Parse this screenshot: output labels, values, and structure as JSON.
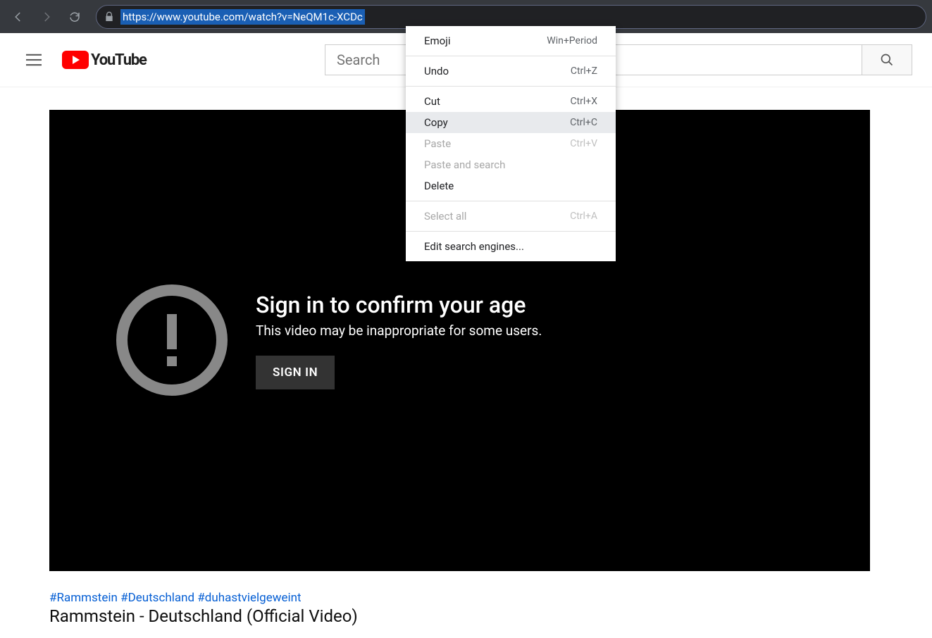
{
  "browser": {
    "url": "https://www.youtube.com/watch?v=NeQM1c-XCDc"
  },
  "context_menu": {
    "items": [
      {
        "label": "Emoji",
        "shortcut": "Win+Period",
        "state": "normal"
      },
      {
        "sep": true
      },
      {
        "label": "Undo",
        "shortcut": "Ctrl+Z",
        "state": "normal"
      },
      {
        "sep": true
      },
      {
        "label": "Cut",
        "shortcut": "Ctrl+X",
        "state": "normal"
      },
      {
        "label": "Copy",
        "shortcut": "Ctrl+C",
        "state": "hover"
      },
      {
        "label": "Paste",
        "shortcut": "Ctrl+V",
        "state": "disabled"
      },
      {
        "label": "Paste and search",
        "shortcut": "",
        "state": "disabled"
      },
      {
        "label": "Delete",
        "shortcut": "",
        "state": "normal"
      },
      {
        "sep": true
      },
      {
        "label": "Select all",
        "shortcut": "Ctrl+A",
        "state": "disabled"
      },
      {
        "sep": true
      },
      {
        "label": "Edit search engines...",
        "shortcut": "",
        "state": "normal"
      }
    ]
  },
  "youtube": {
    "brand": "YouTube",
    "search_placeholder": "Search",
    "age_gate": {
      "heading": "Sign in to confirm your age",
      "sub": "This video may be inappropriate for some users.",
      "button": "SIGN IN"
    },
    "hashtags": [
      "#Rammstein",
      "#Deutschland",
      "#duhastvielgeweint"
    ],
    "title": "Rammstein - Deutschland (Official Video)"
  }
}
